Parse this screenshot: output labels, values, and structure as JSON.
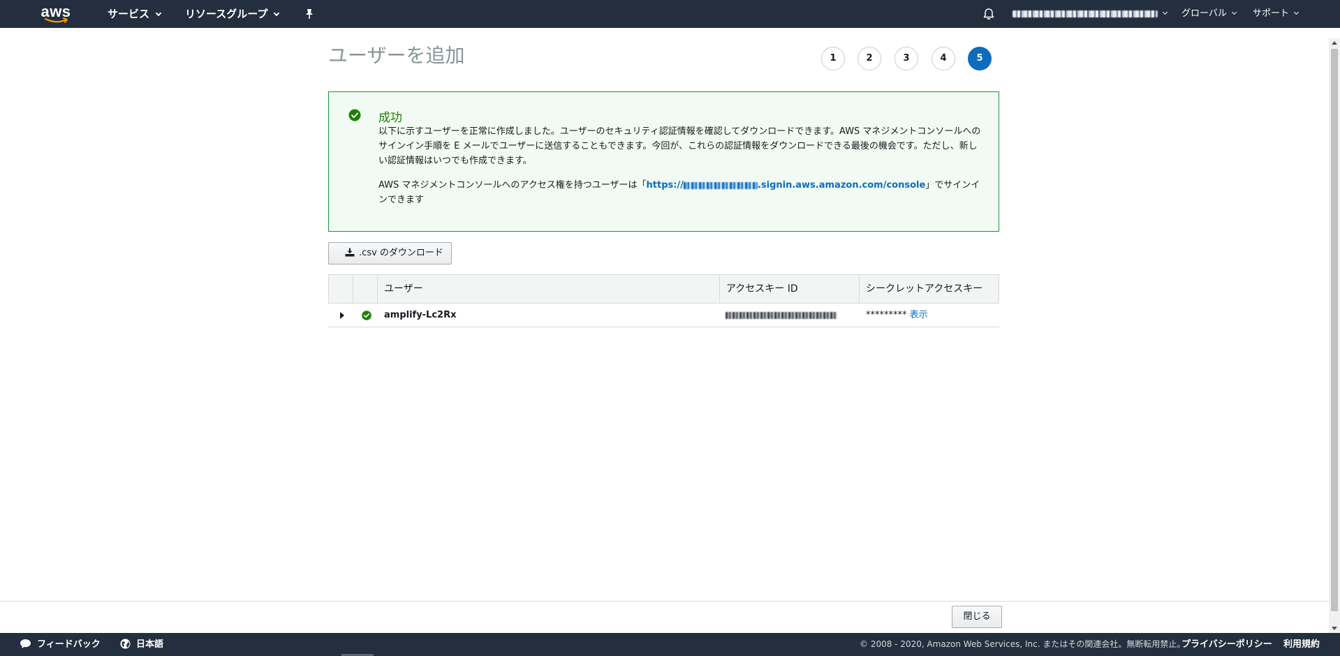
{
  "nav": {
    "logo_text": "aws",
    "services": "サービス",
    "resource_groups": "リソースグループ",
    "region": "グローバル",
    "support": "サポート"
  },
  "page": {
    "title": "ユーザーを追加",
    "steps": [
      "1",
      "2",
      "3",
      "4",
      "5"
    ],
    "active_step": "5"
  },
  "success": {
    "title": "成功",
    "message": "以下に示すユーザーを正常に作成しました。ユーザーのセキュリティ認証情報を確認してダウンロードできます。AWS マネジメントコンソールへのサインイン手順を E メールでユーザーに送信することもできます。今回が、これらの認証情報をダウンロードできる最後の機会です。ただし、新しい認証情報はいつでも作成できます。",
    "console_prefix": "AWS マネジメントコンソールへのアクセス権を持つユーザーは「",
    "console_url_scheme": "https://",
    "console_url_suffix": ".signin.aws.amazon.com/console",
    "console_suffix": "」でサインインできます"
  },
  "download_button": ".csv のダウンロード",
  "table": {
    "headers": {
      "user": "ユーザー",
      "access_key": "アクセスキー ID",
      "secret_key": "シークレットアクセスキー"
    },
    "rows": [
      {
        "user": "amplify-Lc2Rx",
        "secret_masked": "*********",
        "show_label": "表示"
      }
    ]
  },
  "close_button": "閉じる",
  "footer": {
    "feedback": "フィードバック",
    "language": "日本語",
    "copyright": "© 2008 - 2020, Amazon Web Services, Inc. またはその関連会社。無断転用禁止。",
    "privacy": "プライバシーポリシー",
    "terms": "利用規約"
  },
  "colors": {
    "nav_bg": "#232f3e",
    "active_step": "#0d6bc0",
    "success_border": "#1e8e3e",
    "success_title": "#1d8102",
    "link": "#0d6bc0"
  },
  "icons": [
    "aws-logo",
    "chevron-down-icon",
    "pin-icon",
    "bell-icon",
    "check-circle-icon",
    "download-icon",
    "expand-arrow-icon",
    "chat-bubble-icon",
    "globe-icon"
  ]
}
